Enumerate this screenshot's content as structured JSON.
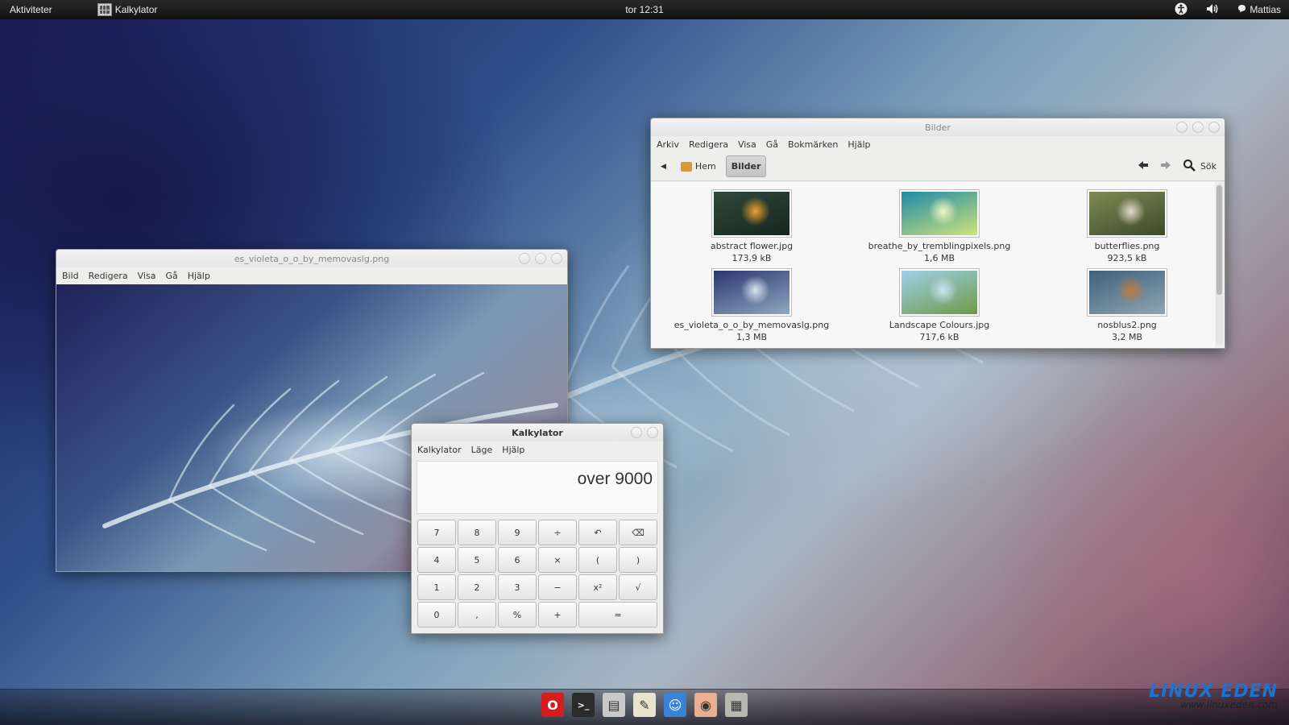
{
  "topbar": {
    "activities": "Aktiviteter",
    "app_name": "Kalkylator",
    "clock": "tor 12:31",
    "user": "Mattias"
  },
  "viewer": {
    "title": "es_violeta_o_o_by_memovaslg.png",
    "menu": [
      "Bild",
      "Redigera",
      "Visa",
      "Gå",
      "Hjälp"
    ]
  },
  "file_manager": {
    "title": "Bilder",
    "menu": [
      "Arkiv",
      "Redigera",
      "Visa",
      "Gå",
      "Bokmärken",
      "Hjälp"
    ],
    "crumbs": {
      "home": "Hem",
      "current": "Bilder"
    },
    "search_label": "Sök",
    "files": [
      {
        "name": "abstract flower.jpg",
        "size": "173,9 kB",
        "colors": [
          "#2f4a3a",
          "#18251f"
        ],
        "accent": "#f0a030"
      },
      {
        "name": "breathe_by_tremblingpixels.png",
        "size": "1,6 MB",
        "colors": [
          "#1d8aa8",
          "#cfe27a"
        ],
        "accent": "#f0f5c0"
      },
      {
        "name": "butterflies.png",
        "size": "923,5 kB",
        "colors": [
          "#7f8a55",
          "#3d4a2a"
        ],
        "accent": "#e8d8d0"
      },
      {
        "name": "es_violeta_o_o_by_memovaslg.png",
        "size": "1,3 MB",
        "colors": [
          "#2b3670",
          "#8fa8c0"
        ],
        "accent": "#d8e6f0"
      },
      {
        "name": "Landscape Colours.jpg",
        "size": "717,6 kB",
        "colors": [
          "#9fd0e8",
          "#6f9a48"
        ],
        "accent": "#c8e6f2"
      },
      {
        "name": "nosblus2.png",
        "size": "3,2 MB",
        "colors": [
          "#3f5f7a",
          "#8fa6b4"
        ],
        "accent": "#c07a40"
      }
    ]
  },
  "calculator": {
    "title": "Kalkylator",
    "menu": [
      "Kalkylator",
      "Läge",
      "Hjälp"
    ],
    "display": "over 9000",
    "keys": [
      [
        "7",
        "8",
        "9",
        "÷",
        "↶",
        "⌫"
      ],
      [
        "4",
        "5",
        "6",
        "×",
        "(",
        ")"
      ],
      [
        "1",
        "2",
        "3",
        "−",
        "x²",
        "√"
      ],
      [
        "0",
        ",",
        "%",
        "+",
        "="
      ]
    ]
  },
  "dock": {
    "items": [
      {
        "name": "opera-icon",
        "glyph": "O",
        "color": "#d41e1e"
      },
      {
        "name": "terminal-icon",
        "glyph": ">_",
        "color": "#2b2b2b"
      },
      {
        "name": "file-manager-icon",
        "glyph": "▤",
        "color": "#c8c8c8"
      },
      {
        "name": "text-editor-icon",
        "glyph": "✎",
        "color": "#e8e4d0"
      },
      {
        "name": "messenger-icon",
        "glyph": "☺",
        "color": "#3a82d8"
      },
      {
        "name": "image-viewer-icon",
        "glyph": "◉",
        "color": "#e8b090"
      },
      {
        "name": "calculator-icon",
        "glyph": "▦",
        "color": "#b8b8b0"
      }
    ]
  },
  "watermark": {
    "logo": "LINUX EDEN",
    "url": "www.linuxeden.com"
  }
}
